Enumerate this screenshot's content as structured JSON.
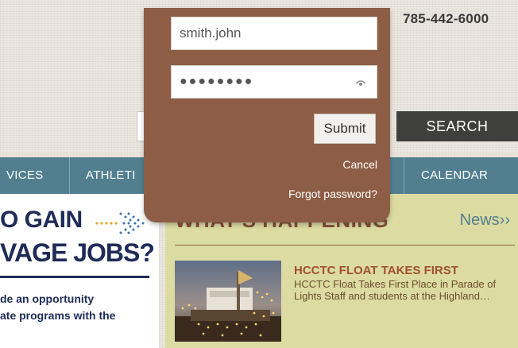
{
  "header": {
    "phone": "785-442-6000"
  },
  "search": {
    "input_value": "",
    "button_label": "SEARCH"
  },
  "nav": {
    "items": [
      {
        "label": "VICES"
      },
      {
        "label": "ATHLETI"
      },
      {
        "label": "CALENDAR"
      }
    ]
  },
  "promo": {
    "line1": "O GAIN",
    "line2": "VAGE JOBS?",
    "text1": "de an opportunity",
    "text2": "ate programs with the"
  },
  "news": {
    "section_title": "WHAT'S HAPPENING",
    "more_link": "News››",
    "headline": "HCCTC FLOAT TAKES FIRST",
    "body": "HCCTC Float Takes First Place in Parade of Lights Staff and students at the Highland…"
  },
  "login": {
    "username_value": "smith.john",
    "password_value": "●●●●●●●●",
    "submit_label": "Submit",
    "cancel_label": "Cancel",
    "forgot_label": "Forgot password?"
  },
  "colors": {
    "login_panel": "#8d5e45",
    "nav_bar": "#527f90",
    "search_button": "#3f403d",
    "news_background": "#dcdba2",
    "news_title": "#84503a",
    "headline": "#a0512c",
    "promo_text": "#1f2b57"
  }
}
